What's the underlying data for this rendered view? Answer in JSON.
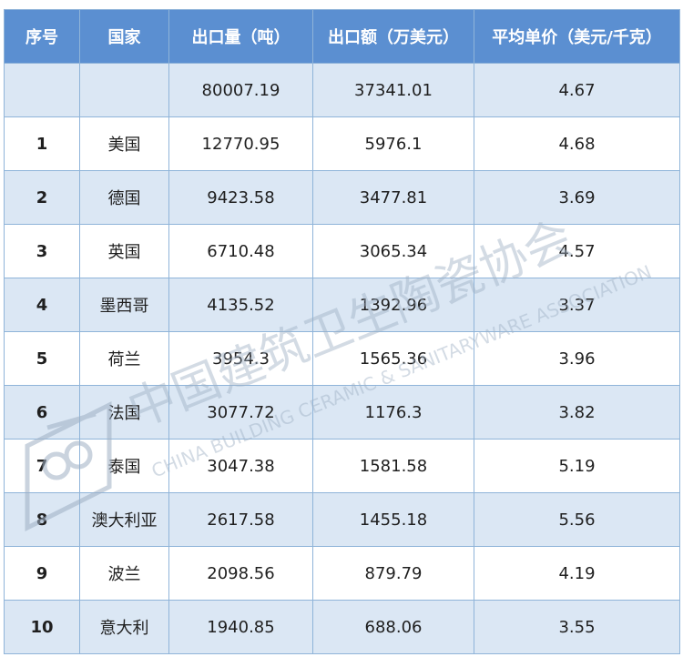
{
  "chart_data": {
    "type": "table",
    "columns": [
      "序号",
      "国家",
      "出口量（吨）",
      "出口额（万美元）",
      "平均单价（美元/千克）"
    ],
    "rows": [
      [
        "",
        "",
        "80007.19",
        "37341.01",
        "4.67"
      ],
      [
        "1",
        "美国",
        "12770.95",
        "5976.1",
        "4.68"
      ],
      [
        "2",
        "德国",
        "9423.58",
        "3477.81",
        "3.69"
      ],
      [
        "3",
        "英国",
        "6710.48",
        "3065.34",
        "4.57"
      ],
      [
        "4",
        "墨西哥",
        "4135.52",
        "1392.96",
        "3.37"
      ],
      [
        "5",
        "荷兰",
        "3954.3",
        "1565.36",
        "3.96"
      ],
      [
        "6",
        "法国",
        "3077.72",
        "1176.3",
        "3.82"
      ],
      [
        "7",
        "泰国",
        "3047.38",
        "1581.58",
        "5.19"
      ],
      [
        "8",
        "澳大利亚",
        "2617.58",
        "1455.18",
        "5.56"
      ],
      [
        "9",
        "波兰",
        "2098.56",
        "879.79",
        "4.19"
      ],
      [
        "10",
        "意大利",
        "1940.85",
        "688.06",
        "3.55"
      ]
    ]
  },
  "watermark": {
    "cn_text": "中国建筑卫生陶瓷协会",
    "en_text": "CHINA BUILDING CERAMIC & SANITARYWARE ASSOCIATION",
    "color": "#9fb0c4"
  },
  "colors": {
    "header_bg": "#5b8fd1",
    "stripe_bg": "#dbe7f4",
    "border": "#8fb4d9"
  }
}
